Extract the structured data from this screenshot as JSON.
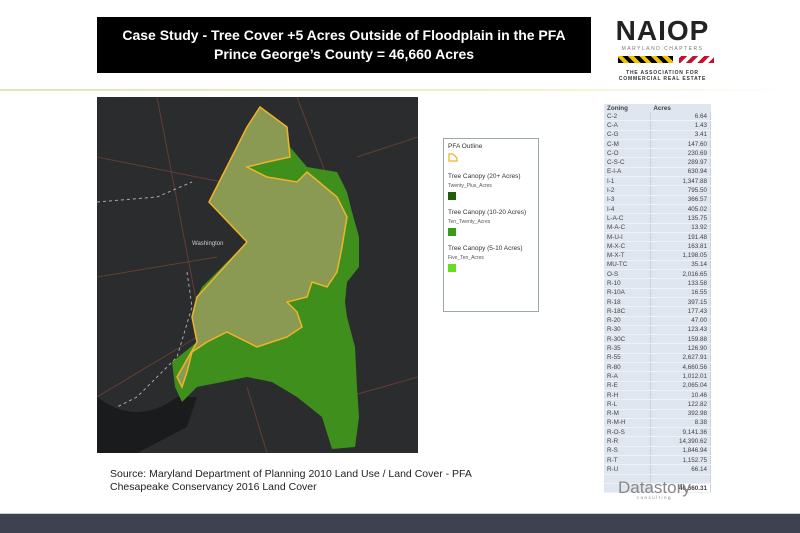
{
  "header": {
    "line1": "Case Study - Tree Cover +5 Acres Outside of Floodplain in the PFA",
    "line2": "Prince George’s County = 46,660 Acres"
  },
  "logo": {
    "name": "NAIOP",
    "subtitle": "MARYLAND CHAPTERS",
    "tagline1": "THE ASSOCIATION FOR",
    "tagline2": "COMMERCIAL REAL ESTATE"
  },
  "map": {
    "label": "Washington",
    "colors": {
      "background": "#2b2c2e",
      "canopy": "#3f8f1c",
      "pfa_fill": "#8a9a52",
      "pfa_outline": "#f0b429"
    }
  },
  "legend": {
    "title": "PFA Outline",
    "items": [
      {
        "heading": "Tree Canopy (20+ Acres)",
        "sub": "Twenty_Plus_Acres",
        "color": "#1e5e0e"
      },
      {
        "heading": "Tree Canopy (10-20 Acres)",
        "sub": "Ten_Twenty_Acres",
        "color": "#3a9a1a"
      },
      {
        "heading": "Tree Canopy (5-10 Acres)",
        "sub": "Five_Ten_Acres",
        "color": "#66dd22"
      }
    ]
  },
  "table": {
    "headers": [
      "Zoning",
      "Acres"
    ],
    "rows": [
      [
        "C-2",
        "6.64"
      ],
      [
        "C-A",
        "1.43"
      ],
      [
        "C-G",
        "3.41"
      ],
      [
        "C-M",
        "147.60"
      ],
      [
        "C-O",
        "230.69"
      ],
      [
        "C-S-C",
        "289.97"
      ],
      [
        "E-I-A",
        "630.94"
      ],
      [
        "I-1",
        "1,347.88"
      ],
      [
        "I-2",
        "795.50"
      ],
      [
        "I-3",
        "366.57"
      ],
      [
        "I-4",
        "405.02"
      ],
      [
        "L-A-C",
        "135.75"
      ],
      [
        "M-A-C",
        "13.92"
      ],
      [
        "M-U-I",
        "191.48"
      ],
      [
        "M-X-C",
        "163.81"
      ],
      [
        "M-X-T",
        "1,198.05"
      ],
      [
        "MU-TC",
        "35.14"
      ],
      [
        "O-S",
        "2,016.65"
      ],
      [
        "R-10",
        "133.58"
      ],
      [
        "R-10A",
        "16.55"
      ],
      [
        "R-18",
        "397.15"
      ],
      [
        "R-18C",
        "177.43"
      ],
      [
        "R-20",
        "47.00"
      ],
      [
        "R-30",
        "123.43"
      ],
      [
        "R-30C",
        "159.88"
      ],
      [
        "R-35",
        "126.90"
      ],
      [
        "R-55",
        "2,627.91"
      ],
      [
        "R-80",
        "4,660.56"
      ],
      [
        "R-A",
        "1,012.01"
      ],
      [
        "R-E",
        "2,065.04"
      ],
      [
        "R-H",
        "10.46"
      ],
      [
        "R-L",
        "122.82"
      ],
      [
        "R-M",
        "392.98"
      ],
      [
        "R-M-H",
        "8.38"
      ],
      [
        "R-O-S",
        "9,141.36"
      ],
      [
        "R-R",
        "14,390.62"
      ],
      [
        "R-S",
        "1,846.94"
      ],
      [
        "R-T",
        "1,152.75"
      ],
      [
        "R-U",
        "66.14"
      ]
    ],
    "total": "46,660.31"
  },
  "source": {
    "line1": "Source: Maryland Department of Planning 2010 Land Use / Land Cover - PFA",
    "line2": "Chesapeake Conservancy 2016 Land Cover"
  },
  "datastory": {
    "name": "Datastory",
    "sub": "consulting"
  }
}
